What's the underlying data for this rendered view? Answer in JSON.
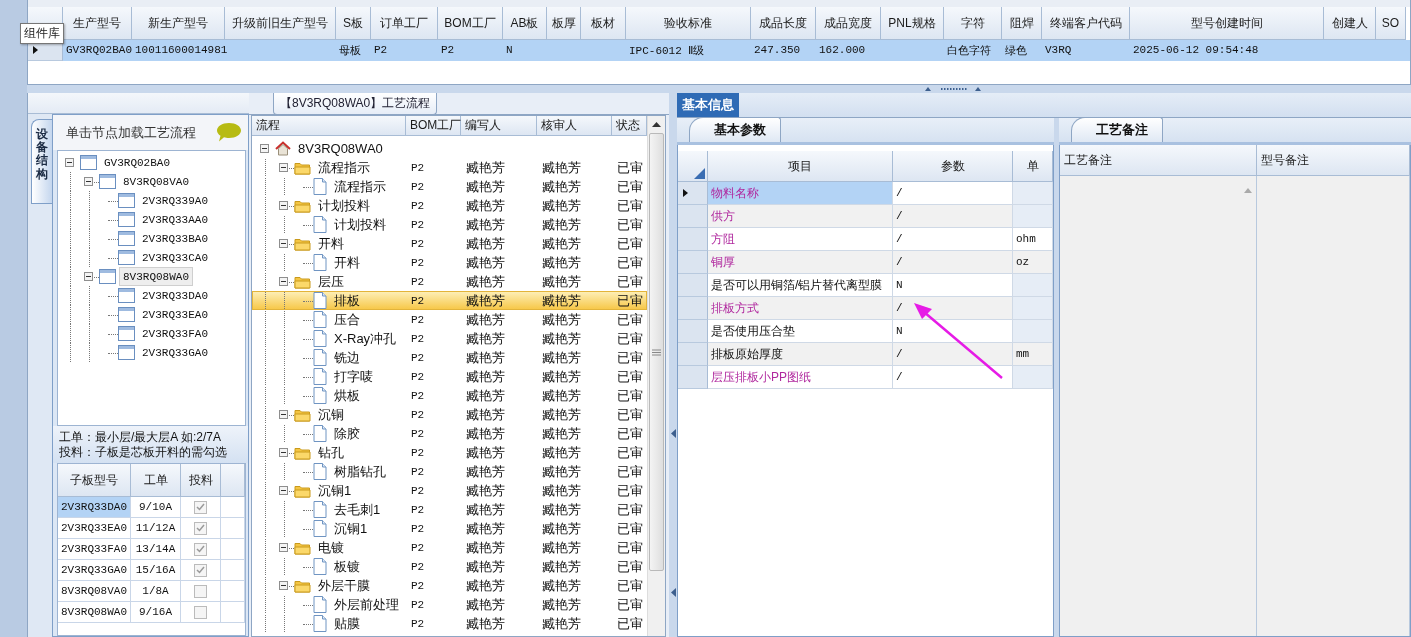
{
  "tooltip": "组件库",
  "top_grid": {
    "columns": [
      "生产型号",
      "新生产型号",
      "升级前旧生产型号",
      "S板",
      "订单工厂",
      "BOM工厂",
      "AB板",
      "板厚",
      "板材",
      "验收标准",
      "成品长度",
      "成品宽度",
      "PNL规格",
      "字符",
      "阻焊",
      "终端客户代码",
      "型号创建时间",
      "创建人",
      "SO"
    ],
    "rows": [
      {
        "selected": true,
        "cells": [
          "GV3RQ02BA0",
          "10011600014981",
          null,
          "母板",
          "P2",
          "P2",
          "N",
          null,
          null,
          "IPC-6012 Ⅱ级",
          "247.350",
          "162.000",
          null,
          "白色字符",
          "绿色",
          "V3RQ",
          "2025-06-12 09:54:48",
          null,
          null
        ]
      }
    ]
  },
  "side_tabs": [
    {
      "label": "设备结构",
      "selected": true
    }
  ],
  "device_panel": {
    "hint": "单击节点加载工艺流程",
    "tree": [
      {
        "label": "GV3RQ02BA0",
        "selected": false,
        "expanded": true,
        "children": [
          {
            "label": "8V3RQ08VA0",
            "selected": false,
            "expanded": true,
            "children": [
              {
                "label": "2V3RQ339A0",
                "selected": false
              },
              {
                "label": "2V3RQ33AA0",
                "selected": false
              },
              {
                "label": "2V3RQ33BA0",
                "selected": false
              },
              {
                "label": "2V3RQ33CA0",
                "selected": false
              }
            ]
          },
          {
            "label": "8V3RQ08WA0",
            "selected": true,
            "expanded": true,
            "children": [
              {
                "label": "2V3RQ33DA0",
                "selected": false
              },
              {
                "label": "2V3RQ33EA0",
                "selected": false
              },
              {
                "label": "2V3RQ33FA0",
                "selected": false
              },
              {
                "label": "2V3RQ33GA0",
                "selected": false
              }
            ]
          }
        ]
      }
    ],
    "notes": [
      "工单：最小层/最大层A 如:2/7A",
      "投料：子板是芯板开料的需勾选"
    ],
    "sub_table": {
      "columns": [
        "子板型号",
        "工单",
        "投料"
      ],
      "rows": [
        {
          "board": "2V3RQ33DA0",
          "order": "9/10A",
          "checked": true,
          "selected": true
        },
        {
          "board": "2V3RQ33EA0",
          "order": "11/12A",
          "checked": true,
          "selected": false
        },
        {
          "board": "2V3RQ33FA0",
          "order": "13/14A",
          "checked": true,
          "selected": false
        },
        {
          "board": "2V3RQ33GA0",
          "order": "15/16A",
          "checked": true,
          "selected": false
        },
        {
          "board": "8V3RQ08VA0",
          "order": "1/8A",
          "checked": false,
          "selected": false
        },
        {
          "board": "8V3RQ08WA0",
          "order": "9/16A",
          "checked": false,
          "selected": false
        }
      ]
    }
  },
  "flow": {
    "tab": {
      "label": "【8V3RQ08WA0】工艺流程",
      "selected": true
    },
    "columns": [
      "流程",
      "BOM工厂",
      "编写人",
      "核审人",
      "状态"
    ],
    "tree": [
      {
        "kind": "root",
        "label": "8V3RQ08WA0",
        "selected": false,
        "expanded": true,
        "children": [
          {
            "kind": "folder",
            "label": "流程指示",
            "bom": "P2",
            "writer": "臧艳芳",
            "reviewer": "臧艳芳",
            "status": "已审",
            "selected": false,
            "expanded": true,
            "children": [
              {
                "kind": "step",
                "label": "流程指示",
                "bom": "P2",
                "writer": "臧艳芳",
                "reviewer": "臧艳芳",
                "status": "已审",
                "selected": false
              }
            ]
          },
          {
            "kind": "folder",
            "label": "计划投料",
            "bom": "P2",
            "writer": "臧艳芳",
            "reviewer": "臧艳芳",
            "status": "已审",
            "selected": false,
            "expanded": true,
            "children": [
              {
                "kind": "step",
                "label": "计划投料",
                "bom": "P2",
                "writer": "臧艳芳",
                "reviewer": "臧艳芳",
                "status": "已审",
                "selected": false
              }
            ]
          },
          {
            "kind": "folder",
            "label": "开料",
            "bom": "P2",
            "writer": "臧艳芳",
            "reviewer": "臧艳芳",
            "status": "已审",
            "selected": false,
            "expanded": true,
            "children": [
              {
                "kind": "step",
                "label": "开料",
                "bom": "P2",
                "writer": "臧艳芳",
                "reviewer": "臧艳芳",
                "status": "已审",
                "selected": false
              }
            ]
          },
          {
            "kind": "folder",
            "label": "层压",
            "bom": "P2",
            "writer": "臧艳芳",
            "reviewer": "臧艳芳",
            "status": "已审",
            "selected": false,
            "expanded": true,
            "children": [
              {
                "kind": "step",
                "label": "排板",
                "bom": "P2",
                "writer": "臧艳芳",
                "reviewer": "臧艳芳",
                "status": "已审",
                "selected": true
              },
              {
                "kind": "step",
                "label": "压合",
                "bom": "P2",
                "writer": "臧艳芳",
                "reviewer": "臧艳芳",
                "status": "已审",
                "selected": false
              },
              {
                "kind": "step",
                "label": "X-Ray冲孔",
                "bom": "P2",
                "writer": "臧艳芳",
                "reviewer": "臧艳芳",
                "status": "已审",
                "selected": false
              },
              {
                "kind": "step",
                "label": "铣边",
                "bom": "P2",
                "writer": "臧艳芳",
                "reviewer": "臧艳芳",
                "status": "已审",
                "selected": false
              },
              {
                "kind": "step",
                "label": "打字唛",
                "bom": "P2",
                "writer": "臧艳芳",
                "reviewer": "臧艳芳",
                "status": "已审",
                "selected": false
              },
              {
                "kind": "step",
                "label": "烘板",
                "bom": "P2",
                "writer": "臧艳芳",
                "reviewer": "臧艳芳",
                "status": "已审",
                "selected": false
              }
            ]
          },
          {
            "kind": "folder",
            "label": "沉铜",
            "bom": "P2",
            "writer": "臧艳芳",
            "reviewer": "臧艳芳",
            "status": "已审",
            "selected": false,
            "expanded": true,
            "children": [
              {
                "kind": "step",
                "label": "除胶",
                "bom": "P2",
                "writer": "臧艳芳",
                "reviewer": "臧艳芳",
                "status": "已审",
                "selected": false
              }
            ]
          },
          {
            "kind": "folder",
            "label": "钻孔",
            "bom": "P2",
            "writer": "臧艳芳",
            "reviewer": "臧艳芳",
            "status": "已审",
            "selected": false,
            "expanded": true,
            "children": [
              {
                "kind": "step",
                "label": "树脂钻孔",
                "bom": "P2",
                "writer": "臧艳芳",
                "reviewer": "臧艳芳",
                "status": "已审",
                "selected": false
              }
            ]
          },
          {
            "kind": "folder",
            "label": "沉铜1",
            "bom": "P2",
            "writer": "臧艳芳",
            "reviewer": "臧艳芳",
            "status": "已审",
            "selected": false,
            "expanded": true,
            "children": [
              {
                "kind": "step",
                "label": "去毛刺1",
                "bom": "P2",
                "writer": "臧艳芳",
                "reviewer": "臧艳芳",
                "status": "已审",
                "selected": false
              },
              {
                "kind": "step",
                "label": "沉铜1",
                "bom": "P2",
                "writer": "臧艳芳",
                "reviewer": "臧艳芳",
                "status": "已审",
                "selected": false
              }
            ]
          },
          {
            "kind": "folder",
            "label": "电镀",
            "bom": "P2",
            "writer": "臧艳芳",
            "reviewer": "臧艳芳",
            "status": "已审",
            "selected": false,
            "expanded": true,
            "children": [
              {
                "kind": "step",
                "label": "板镀",
                "bom": "P2",
                "writer": "臧艳芳",
                "reviewer": "臧艳芳",
                "status": "已审",
                "selected": false
              }
            ]
          },
          {
            "kind": "folder",
            "label": "外层干膜",
            "bom": "P2",
            "writer": "臧艳芳",
            "reviewer": "臧艳芳",
            "status": "已审",
            "selected": false,
            "expanded": true,
            "children": [
              {
                "kind": "step",
                "label": "外层前处理",
                "bom": "P2",
                "writer": "臧艳芳",
                "reviewer": "臧艳芳",
                "status": "已审",
                "selected": false
              },
              {
                "kind": "step",
                "label": "贴膜",
                "bom": "P2",
                "writer": "臧艳芳",
                "reviewer": "臧艳芳",
                "status": "已审",
                "selected": false
              }
            ]
          }
        ]
      }
    ]
  },
  "info_tabs": [
    {
      "label": "基本信息",
      "selected": true
    }
  ],
  "params": {
    "tab": {
      "label": "基本参数",
      "selected": true
    },
    "columns": [
      "项目",
      "参数",
      "单"
    ],
    "rows": [
      {
        "name": "物料名称",
        "value": "/",
        "required": true,
        "selected": true
      },
      {
        "name": "供方",
        "value": "/",
        "required": true,
        "selected": false
      },
      {
        "name": "方阻",
        "value": "/",
        "unit": "ohm",
        "required": true,
        "selected": false
      },
      {
        "name": "铜厚",
        "value": "/",
        "unit": "oz",
        "required": true,
        "selected": false
      },
      {
        "name": "是否可以用铜箔/铝片替代离型膜",
        "value": "N",
        "required": false,
        "selected": false
      },
      {
        "name": "排板方式",
        "value": "/",
        "required": true,
        "selected": false
      },
      {
        "name": "是否使用压合垫",
        "value": "N",
        "required": false,
        "selected": false
      },
      {
        "name": "排板原始厚度",
        "value": "/",
        "unit": "mm",
        "required": false,
        "selected": false
      },
      {
        "name": "层压排板小PP图纸",
        "value": "/",
        "required": true,
        "selected": false
      }
    ]
  },
  "remarks": {
    "tab": {
      "label": "工艺备注",
      "selected": true
    },
    "columns": [
      "工艺备注",
      "型号备注"
    ]
  }
}
